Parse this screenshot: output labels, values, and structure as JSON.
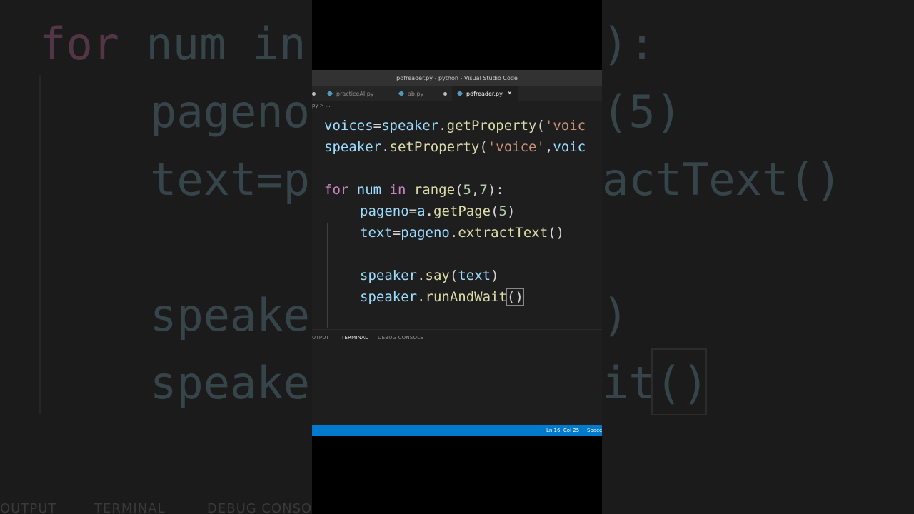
{
  "backdrop": {
    "line1_kw": "for",
    "line1_rest": " num in",
    "line1_right": "):",
    "line2_left": "pageno",
    "line2_right": "(5)",
    "line3_left": "text=p",
    "line3_right": "actText()",
    "line4_left": "speake",
    "line4_right": ")",
    "line5_left": "speake",
    "line5_right": "it()",
    "panel_output": "OUTPUT",
    "panel_terminal": "TERMINAL",
    "panel_debug": "DEBUG CONSO"
  },
  "window": {
    "title": "pdfreader.py - python - Visual Studio Code",
    "tabs": [
      {
        "label": "practiceAI.py"
      },
      {
        "label": "ab.py"
      },
      {
        "label": "pdfreader.py",
        "close": "×"
      }
    ],
    "breadcrumb": "py > ...",
    "code": {
      "l1": {
        "a": "voices",
        "b": "=",
        "c": "speaker",
        "d": ".",
        "e": "getProperty",
        "f": "(",
        "g": "'voic"
      },
      "l2": {
        "a": "speaker",
        "b": ".",
        "c": "setProperty",
        "d": "(",
        "e": "'voice'",
        "f": ",",
        "g": "voic"
      },
      "l3": {
        "kw1": "for",
        "v1": " num ",
        "kw2": "in",
        "fn": " range",
        "p1": "(",
        "n1": "5",
        "c": ",",
        "n2": "7",
        "p2": "):"
      },
      "l4": {
        "a": "pageno",
        "b": "=",
        "c": "a",
        "d": ".",
        "e": "getPage",
        "f": "(",
        "g": "5",
        "h": ")"
      },
      "l5": {
        "a": "text",
        "b": "=",
        "c": "pageno",
        "d": ".",
        "e": "extractText",
        "f": "()"
      },
      "l6": {
        "a": "speaker",
        "b": ".",
        "c": "say",
        "d": "(",
        "e": "text",
        "f": ")"
      },
      "l7": {
        "a": "speaker",
        "b": ".",
        "c": "runAndWait",
        "d": "()"
      }
    },
    "panel_tabs": [
      "UTPUT",
      "TERMINAL",
      "DEBUG CONSOLE"
    ],
    "status": {
      "position": "Ln 16, Col 25",
      "spaces": "Space"
    }
  },
  "colors": {
    "statusbar": "#007acc",
    "editor_bg": "#1e1e1e"
  }
}
